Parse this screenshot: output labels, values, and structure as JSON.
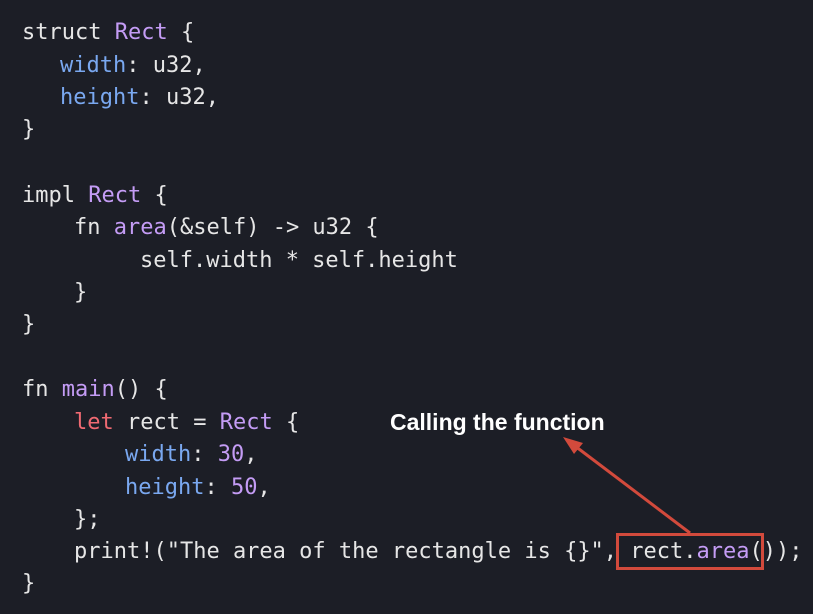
{
  "code": {
    "l1": {
      "kw": "struct",
      "sp": " ",
      "ty": "Rect",
      "rest": " {"
    },
    "l2": {
      "fld": "width",
      "rest": ": u32,"
    },
    "l3": {
      "fld": "height",
      "rest": ": u32,"
    },
    "l4": {
      "rest": "}"
    },
    "l6": {
      "kw": "impl",
      "sp": " ",
      "ty": "Rect",
      "rest": " {"
    },
    "l7": {
      "kw": "fn",
      "sp": " ",
      "fn": "area",
      "rest": "(&self) -> u32 {"
    },
    "l8": {
      "rest": "self.width * self.height"
    },
    "l9": {
      "rest": "}"
    },
    "l10": {
      "rest": "}"
    },
    "l12": {
      "kw": "fn",
      "sp": " ",
      "fn": "main",
      "rest": "() {"
    },
    "l13": {
      "let": "let",
      "mid": " rect = ",
      "ty": "Rect",
      "rest": " {"
    },
    "l14": {
      "fld": "width",
      "mid": ": ",
      "num": "30",
      "rest": ","
    },
    "l15": {
      "fld": "height",
      "mid": ": ",
      "num": "50",
      "rest": ","
    },
    "l16": {
      "rest": "};"
    },
    "l17": {
      "pre": "print!(\"The area of the rectangle is {}\", ",
      "obj": "rect.",
      "fn": "area",
      "call": "()",
      "rest": ");"
    },
    "l18": {
      "rest": "}"
    }
  },
  "annotation": {
    "label": "Calling the function",
    "color": "#d24a3c"
  }
}
